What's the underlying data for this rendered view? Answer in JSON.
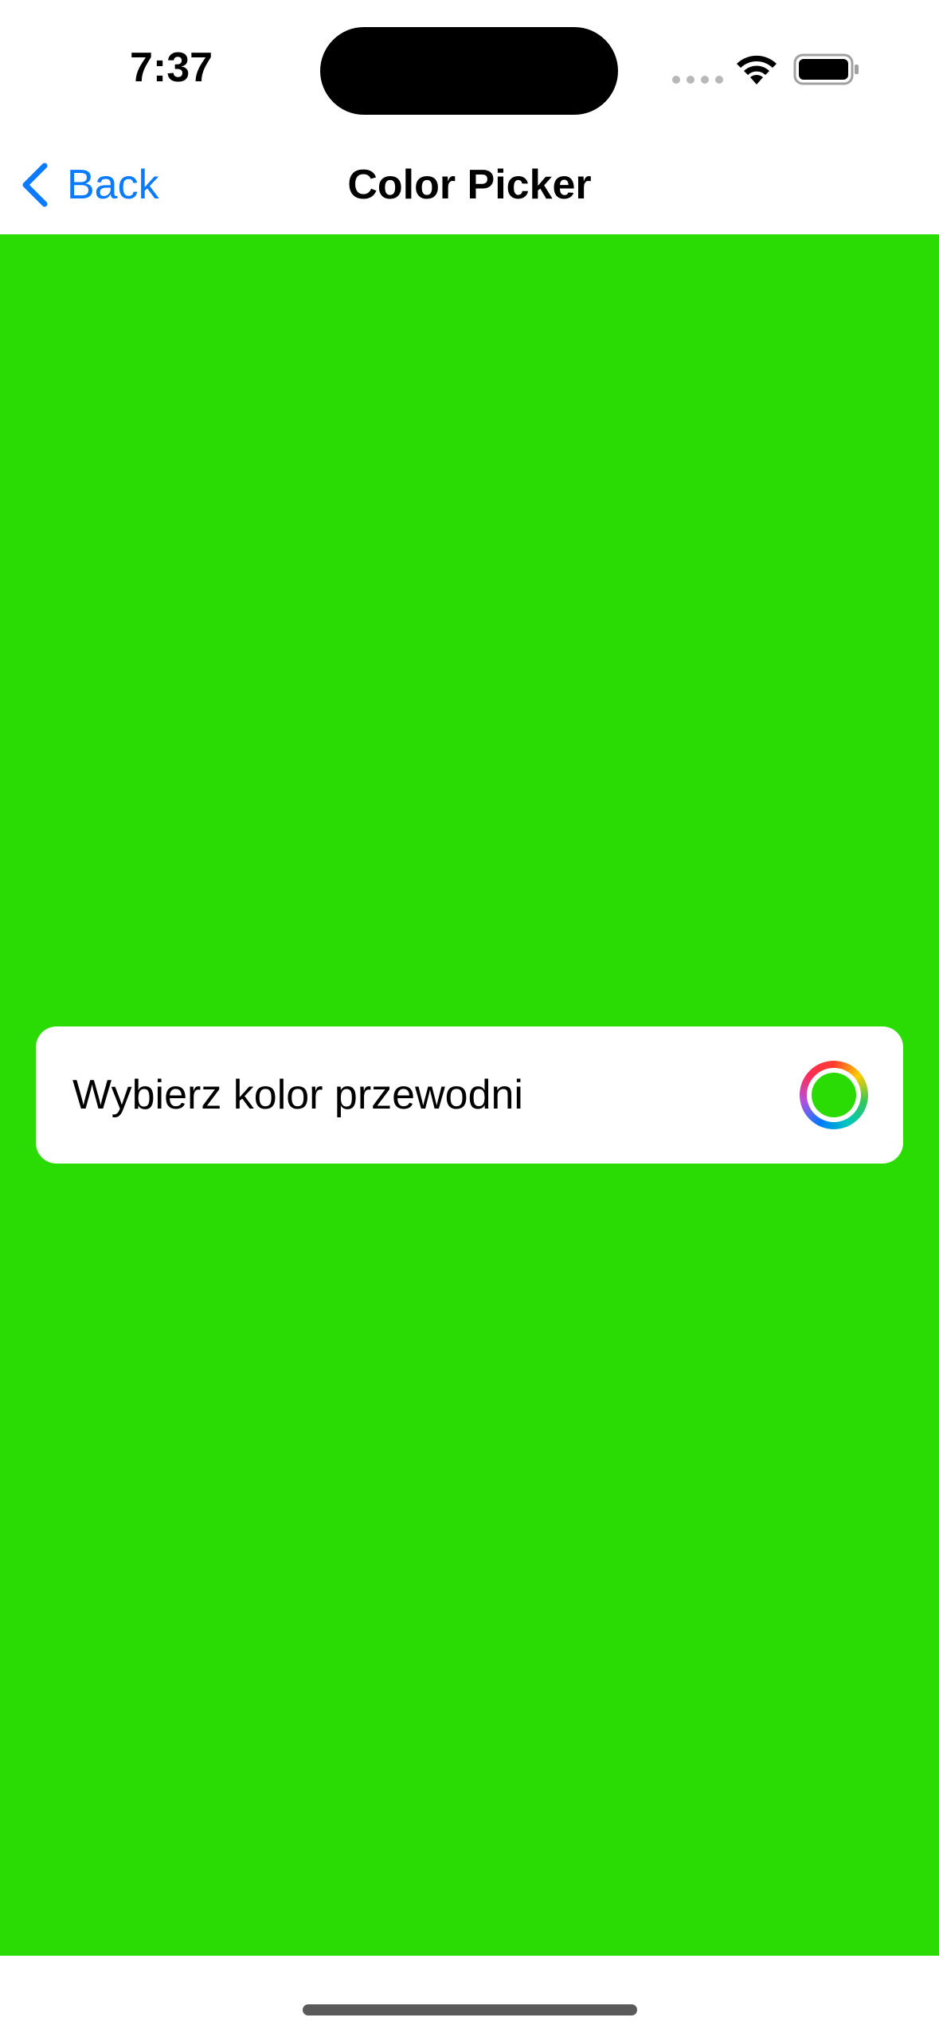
{
  "status_bar": {
    "time": "7:37",
    "icons": [
      "signal-dots-icon",
      "wifi-icon",
      "battery-icon"
    ]
  },
  "nav_bar": {
    "back_label": "Back",
    "back_icon": "chevron-left-icon",
    "title": "Color Picker"
  },
  "content": {
    "background_color": "#2adc04",
    "picker_label": "Wybierz kolor przewodni",
    "selected_color": "#2adc04"
  },
  "colors": {
    "accent": "#0a7aff",
    "card": "#ffffff"
  }
}
